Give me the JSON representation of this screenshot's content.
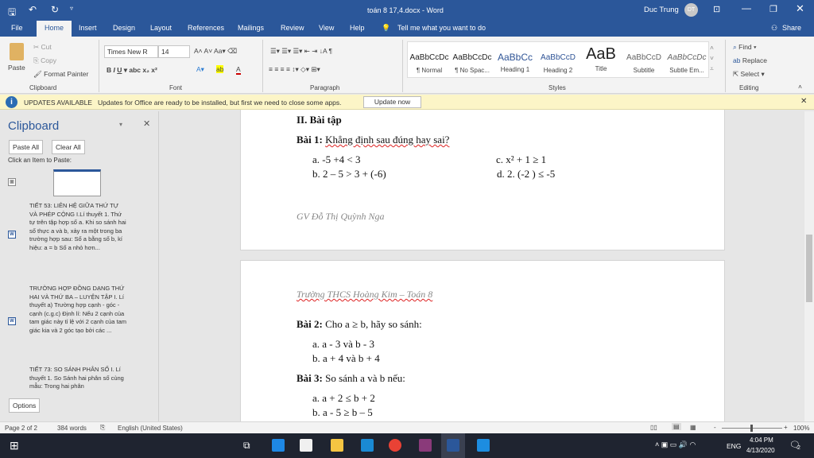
{
  "titlebar": {
    "doc_title": "toán 8 17,4.docx  -  Word",
    "user": "Duc Trung",
    "avatar_initials": "DT"
  },
  "tabs": [
    "File",
    "Home",
    "Insert",
    "Design",
    "Layout",
    "References",
    "Mailings",
    "Review",
    "View",
    "Help"
  ],
  "tell_me": "Tell me what you want to do",
  "share": "Share",
  "clipboard_group": {
    "paste": "Paste",
    "cut": "Cut",
    "copy": "Copy",
    "format_painter": "Format Painter",
    "label": "Clipboard"
  },
  "font_group": {
    "font_name": "Times New R",
    "font_size": "14",
    "label": "Font"
  },
  "paragraph_group": {
    "label": "Paragraph"
  },
  "styles": {
    "label": "Styles",
    "items": [
      {
        "sample": "AaBbCcDc",
        "name": "¶ Normal"
      },
      {
        "sample": "AaBbCcDc",
        "name": "¶ No Spac..."
      },
      {
        "sample": "AaBbCc",
        "name": "Heading 1"
      },
      {
        "sample": "AaBbCcD",
        "name": "Heading 2"
      },
      {
        "sample": "AaB",
        "name": "Title"
      },
      {
        "sample": "AaBbCcD",
        "name": "Subtitle"
      },
      {
        "sample": "AaBbCcDc",
        "name": "Subtle Em..."
      }
    ]
  },
  "editing": {
    "find": "Find",
    "replace": "Replace",
    "select": "Select",
    "label": "Editing"
  },
  "update_bar": {
    "title": "UPDATES AVAILABLE",
    "message": "Updates for Office are ready to be installed, but first we need to close some apps.",
    "button": "Update now"
  },
  "pane": {
    "title": "Clipboard",
    "paste_all": "Paste All",
    "clear_all": "Clear All",
    "hint": "Click an Item to Paste:",
    "options": "Options",
    "items": [
      "TIẾT 53: LIÊN HỆ GIỮA THỨ TỰ VÀ PHÉP CỘNG I.Lí thuyết 1. Thứ tự trên tập hợp số a. Khi so sánh hai số thực a và b, xảy ra một trong ba trường hợp sau:  Số a bằng số b, kí hiệu: a = b  Số a nhỏ hơn...",
      "TRƯỜNG HỢP ĐỒNG DẠNG THỨ HAI VÀ THỨ BA – LUYỆN TẬP I. Lí thuyết a) Trường hợp cạnh - góc - cạnh (c.g.c)  Định lí: Nếu 2 cạnh của tam giác này tỉ lệ với 2 cạnh của tam giác kia và 2 góc tạo bởi các ...",
      "TIẾT 73: SO SÁNH PHÂN SỐ I. Lí thuyết 1. So Sánh hai phân số cùng mẫu: Trong hai phân"
    ]
  },
  "doc": {
    "section": "II. Bài tập",
    "bai1_label": "Bài 1:",
    "bai1_text": "Khẳng định sau đúng hay sai?",
    "bai1_items": [
      "a.  -5 +4 < 3",
      "b.  2 – 5 > 3 + (-6)",
      "c. x² + 1 ≥ 1",
      "d. 2. (-2 ) ≤ -5"
    ],
    "footer": "GV Đỗ Thị Quỳnh Nga",
    "header": "Trường THCS Hoàng Kim – Toán 8",
    "bai2_label": "Bài 2:",
    "bai2_text": "Cho a ≥ b, hãy so sánh:",
    "bai2_items": [
      "a.  a - 3 và b - 3",
      "b.  a + 4 và b + 4"
    ],
    "bai3_label": "Bài 3:",
    "bai3_text": "So sánh a và b nếu:",
    "bai3_items": [
      "a.  a + 2 ≤ b + 2",
      "b.  a - 5 ≥ b – 5"
    ]
  },
  "status": {
    "page": "Page 2 of 2",
    "words": "384 words",
    "language": "English (United States)",
    "zoom": "100%",
    "zoom_percent": 100
  },
  "taskbar": {
    "lang": "ENG",
    "time": "4:04 PM",
    "date": "4/13/2020",
    "notifications": "2"
  }
}
